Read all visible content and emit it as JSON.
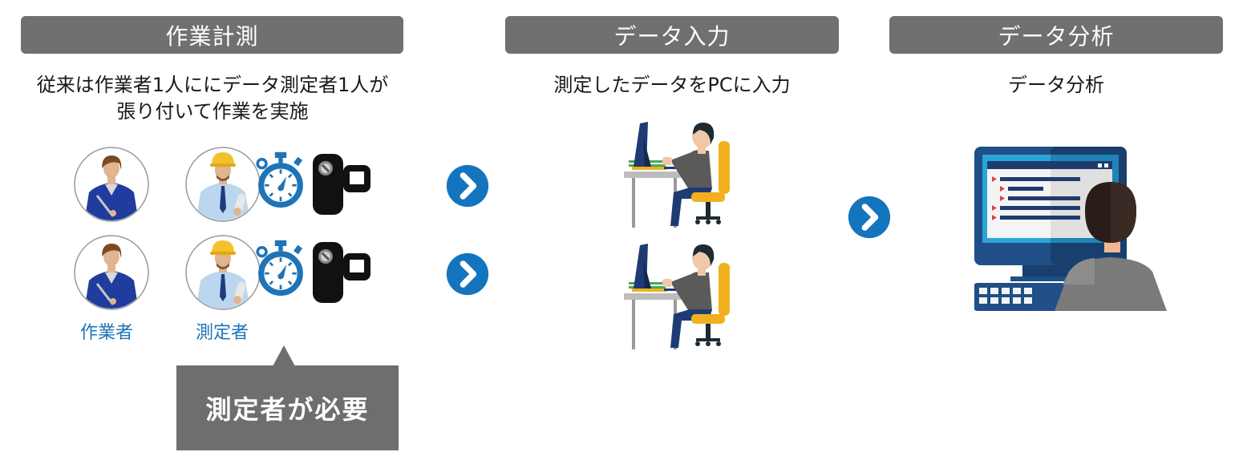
{
  "sections": [
    {
      "id": "measurement",
      "title": "作業計測",
      "description_lines": [
        "従来は作業者1人ににデータ測定者1人が",
        "張り付いて作業を実施"
      ],
      "labels": {
        "worker": "作業者",
        "measurer": "測定者"
      },
      "callout": "測定者が必要",
      "icons": [
        "worker-avatar",
        "measurer-avatar",
        "stopwatch-icon",
        "video-camera-icon"
      ]
    },
    {
      "id": "data-entry",
      "title": "データ入力",
      "description_lines": [
        "測定したデータをPCに入力"
      ],
      "icons": [
        "person-at-desk-icon"
      ]
    },
    {
      "id": "data-analysis",
      "title": "データ分析",
      "description_lines": [
        "データ分析"
      ],
      "icons": [
        "person-at-monitor-icon"
      ]
    }
  ],
  "flow_arrows": [
    "chevron-right-circle-icon",
    "chevron-right-circle-icon",
    "chevron-right-circle-icon"
  ],
  "colors": {
    "header_bg": "#707070",
    "accent_blue": "#1f74b8",
    "callout_bg": "#6e6e6e"
  }
}
